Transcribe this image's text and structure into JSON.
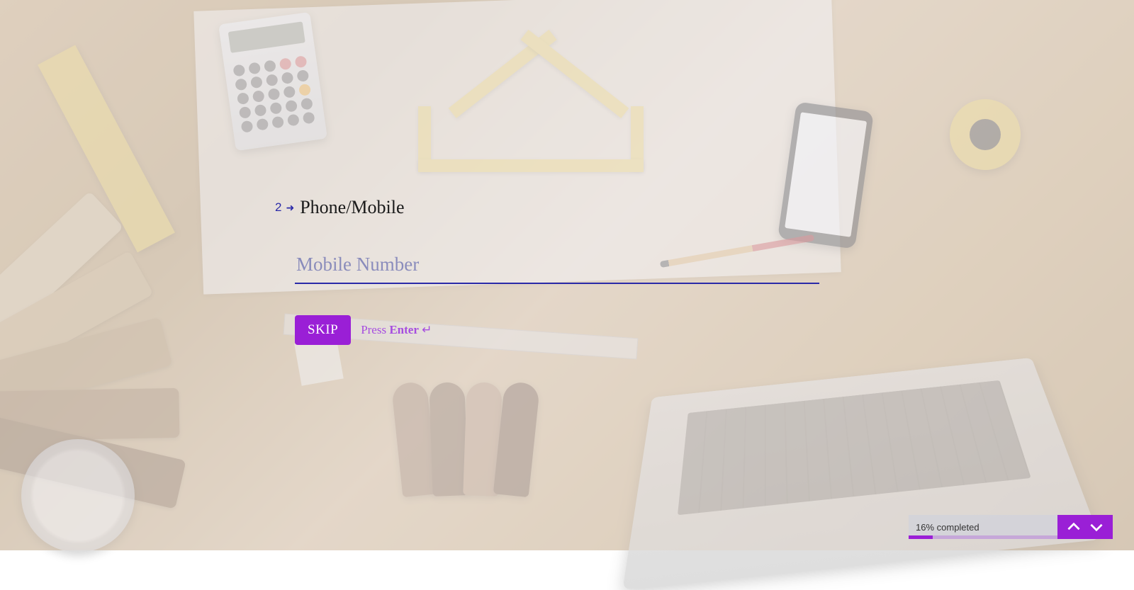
{
  "question": {
    "number": "2",
    "title": "Phone/Mobile",
    "input": {
      "value": "",
      "placeholder": "Mobile Number"
    }
  },
  "controls": {
    "skip_label": "SKIP",
    "hint_prefix": "Press ",
    "hint_key": "Enter",
    "hint_icon": "↵"
  },
  "progress": {
    "percent": 16,
    "label": "16% completed"
  },
  "colors": {
    "accent_purple": "#9a1fd6",
    "accent_blue": "#2a2aa8"
  }
}
